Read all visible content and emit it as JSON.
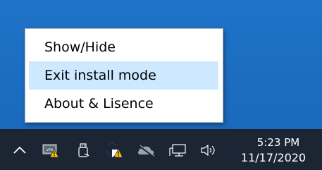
{
  "context_menu": {
    "items": [
      {
        "label": "Show/Hide"
      },
      {
        "label": "Exit install mode"
      },
      {
        "label": "About & Lisence"
      }
    ],
    "highlighted_index": 1
  },
  "taskbar": {
    "tray_icons": [
      {
        "icon": "chevron-up-icon"
      },
      {
        "icon": "vm-warning-icon"
      },
      {
        "icon": "usb-icon"
      },
      {
        "icon": "shield-warning-icon"
      },
      {
        "icon": "onedrive-icon"
      },
      {
        "icon": "network-icon"
      },
      {
        "icon": "volume-icon"
      }
    ],
    "clock": {
      "time": "5:23 PM",
      "date": "11/17/2020"
    }
  },
  "colors": {
    "desktop": "#1c6fc3",
    "taskbar": "#1b2533",
    "menu_highlight": "#cde8ff"
  }
}
